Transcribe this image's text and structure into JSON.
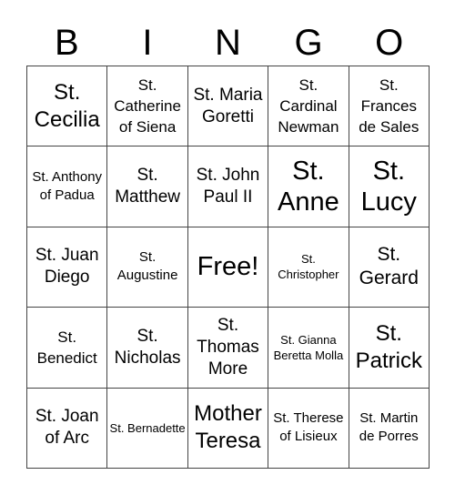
{
  "header": {
    "letters": [
      "B",
      "I",
      "N",
      "G",
      "O"
    ]
  },
  "board": {
    "cells": [
      [
        "St. Cecilia",
        "St. Catherine of Siena",
        "St. Maria Goretti",
        "St. Cardinal Newman",
        "St. Frances de Sales"
      ],
      [
        "St. Anthony of Padua",
        "St. Matthew",
        "St. John Paul II",
        "St. Anne",
        "St. Lucy"
      ],
      [
        "St. Juan Diego",
        "St. Augustine",
        "Free!",
        "St. Christopher",
        "St. Gerard"
      ],
      [
        "St. Benedict",
        "St. Nicholas",
        "St. Thomas More",
        "St. Gianna Beretta Molla",
        "St. Patrick"
      ],
      [
        "St. Joan of Arc",
        "St. Bernadette",
        "Mother Teresa",
        "St. Therese of Lisieux",
        "St. Martin de Porres"
      ]
    ]
  }
}
